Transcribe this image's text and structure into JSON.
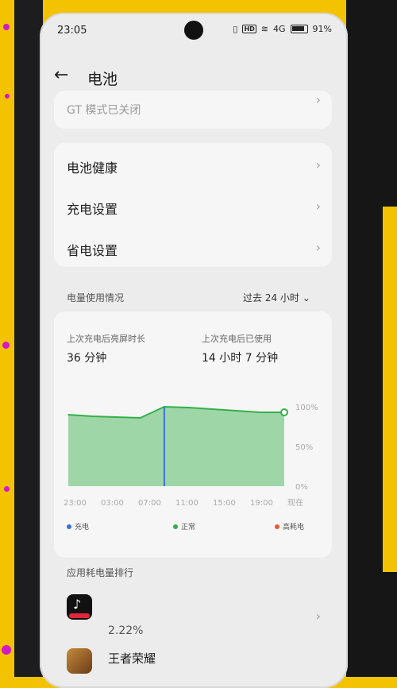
{
  "status": {
    "time": "23:05",
    "hd": "HD",
    "signal": "4G",
    "battery": "91%"
  },
  "header": {
    "back": "←",
    "title": "电池"
  },
  "gt": {
    "text": "GT 模式已关闭"
  },
  "menu": [
    {
      "label": "电池健康"
    },
    {
      "label": "充电设置"
    },
    {
      "label": "省电设置"
    }
  ],
  "usage": {
    "section_label": "电量使用情况",
    "range": "过去 24 小时",
    "stat1_label": "上次充电后亮屏时长",
    "stat1_value": "36 分钟",
    "stat2_label": "上次充电后已使用",
    "stat2_value": "14 小时 7 分钟"
  },
  "chart_data": {
    "type": "area",
    "x": [
      "23:00",
      "03:00",
      "07:00",
      "11:00",
      "15:00",
      "19:00",
      "现在"
    ],
    "series": [
      {
        "values": [
          90,
          88,
          87,
          86,
          100,
          99,
          97,
          95,
          93,
          93
        ]
      }
    ],
    "y_ticks": [
      "100%",
      "50%",
      "0%"
    ],
    "ylim": [
      0,
      100
    ],
    "colors": {
      "normal": "#35b04a",
      "charge": "#3a6fe0",
      "high": "#e85a32"
    }
  },
  "legend": {
    "charge": "充电",
    "normal": "正常",
    "high": "高耗电"
  },
  "ranking": {
    "label": "应用耗电量排行",
    "apps": [
      {
        "name": "",
        "percent": "2.22%",
        "icon": "tiktok-icon"
      },
      {
        "name": "王者荣耀",
        "percent": "",
        "icon": "game-icon"
      }
    ]
  }
}
